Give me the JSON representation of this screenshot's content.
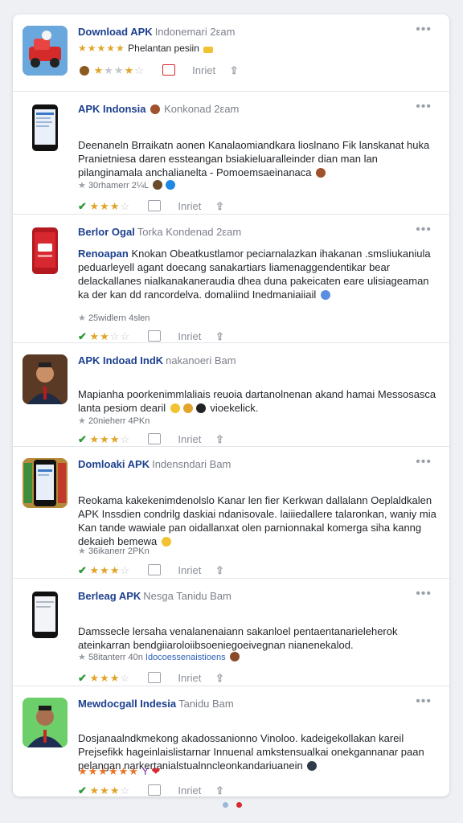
{
  "posts": [
    {
      "title": "Download APK",
      "meta": "Indonemari 2εam",
      "line1_stars": "★★★★★",
      "line1_text": "Phelantan pesiin",
      "action_label": "Inriet"
    },
    {
      "title": "APK Indonsia",
      "meta": "Konkonad 2εam",
      "body": "Deenaneln Brraikatn aonen Kanalaomiandkara lioslnano Fik lanskanat huka Pranietniesa daren essteangan bsiakieluaralleinder dian man lan pilanginamala anchalianelta - Pomoemsaeinanaca",
      "sub": "30rhamerr 2¼L",
      "rating": 3,
      "action_label": "Inriet"
    },
    {
      "title": "Berlor Ogal",
      "meta": "Torka  Kondenad 2εam",
      "body_bold": "Renoapan",
      "body": "Knokan Obeatkustlamor peciarnalazkan ihakanan .smsliukaniula peduarleyell agant doecang sanakartiars liamenaggendentikar bear delackallanes nialkanakaneraudia dhea duna pakeicaten eare ulisiageaman ka der kan dd rancordelva. domaliind Inedmaniaiiail",
      "sub": "25widlern 4slen",
      "rating": 2,
      "action_label": "Inriet"
    },
    {
      "title": "APK Indoad IndK",
      "meta": "nakanoeri Bam",
      "body": "Mapianha poorkenimmlaliais reuoia dartanolnenan akand hamai Messosasca lanta pesiom dearil",
      "body_tail": "vioekelick.",
      "sub": "20nieherr 4PKn",
      "rating": 3,
      "action_label": "Inriet"
    },
    {
      "title": "Domloaki APK",
      "meta": "Indensndari Bam",
      "body": "Reokama kakekenimdenolslo Kanar len fier Kerkwan dallalann Oeplaldkalen APK Inssdien condrilg daskiai ndanisovale. laiiiedallere talaronkan, waniy mia Kan tande wawiale pan oidallanxat olen parnionnakal komerga siha kanng dekaieh bemewa",
      "sub": "36ikanerr 2PKn",
      "rating": 3,
      "action_label": "Inriet"
    },
    {
      "title": "Berleag APK",
      "meta": "Nesga  Tanidu Bam",
      "body": "Damssecle lersaha venalanenaiann sakanloel pentaentanarieleherok ateinkarran bendgiiaroloiibsoeniegoeivegnan nianenekalod.",
      "sub": "58itanterr 40n",
      "sub_link": "Idocoessenaistioens",
      "rating": 3,
      "action_label": "Inriet"
    },
    {
      "title": "Mewdocgall Indesia",
      "meta": "Tanidu Bam",
      "body": "Dosjanaalndkmekong akadossanionno Vinoloo. kadeigekollakan kareil Prejsefikk hageinlaislistarnar Innuenal amkstensualkai onekgannanar paan pelangan narkertanialstualnncleonkandariuanein",
      "reactions_stars": "★★★★★★",
      "reactions_tail": "Y",
      "rating": 3,
      "action_label": "Inriet"
    }
  ],
  "colors": {
    "title_blue": "#1c3f8f",
    "star_gold": "#e0a52a",
    "check_green": "#2e9a3a",
    "heart_red": "#d8282f"
  }
}
